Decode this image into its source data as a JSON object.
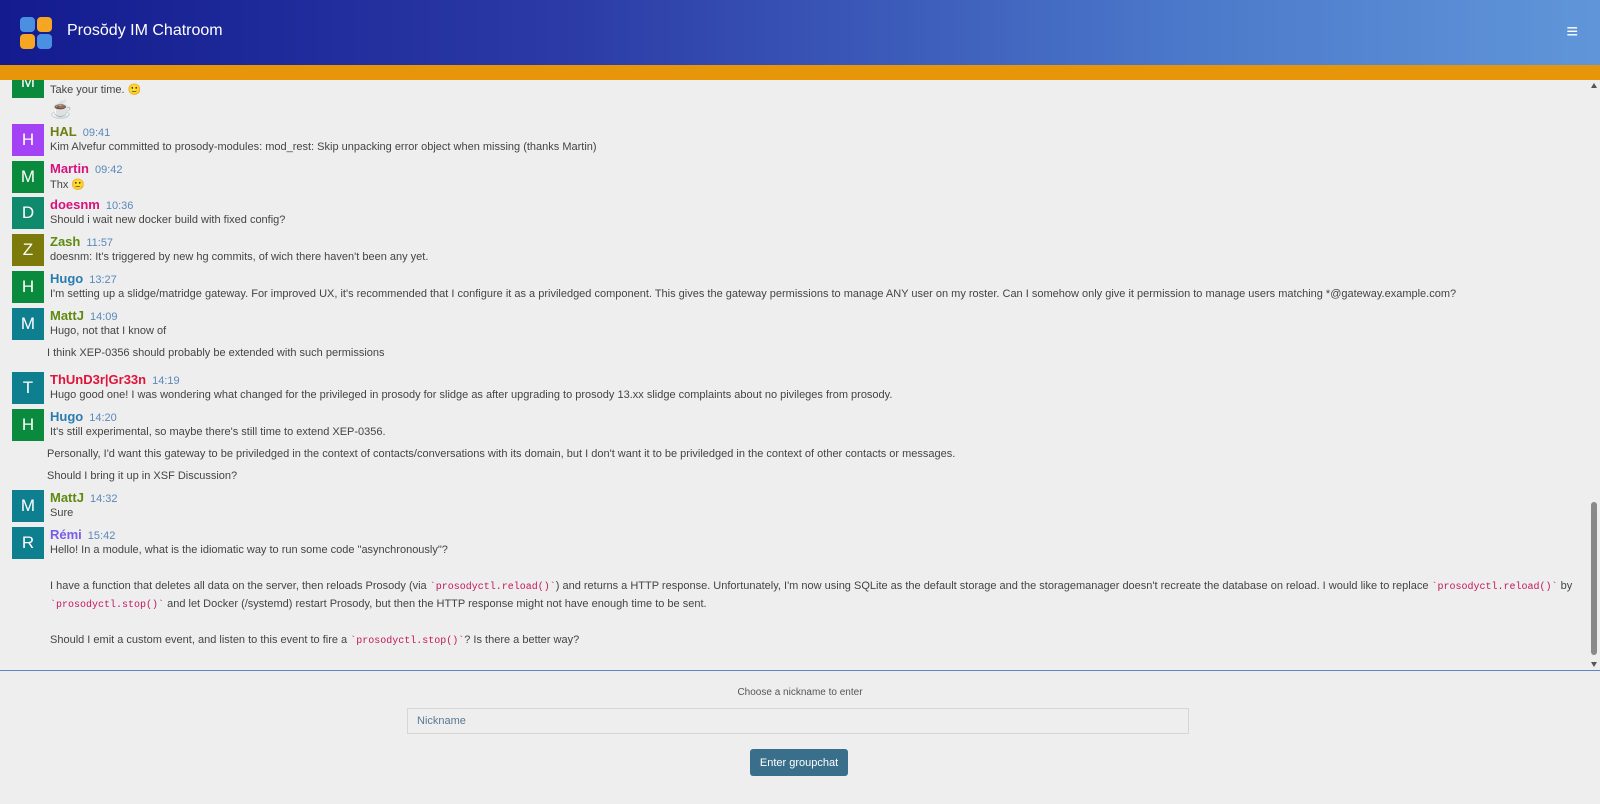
{
  "header": {
    "title": "Prosŏdy IM Chatroom",
    "logo_icon": "prosody-logo-icon",
    "menu_icon": "hamburger-menu-icon",
    "menu_glyph": "≡",
    "colors": {
      "brand_blue": "#131b8e",
      "accent_orange": "#e89609"
    }
  },
  "messages": [
    {
      "text": "Take your time. 🙂",
      "avatar_letter": "M",
      "avatar_color": "#0a8a3c"
    },
    {
      "text": "☕"
    },
    {
      "avatar_letter": "H",
      "avatar_color": "#a442f5",
      "nick": "HAL",
      "nick_color": "#6d7d10",
      "time": "09:41",
      "text": "Kim Alvefur committed to prosody-modules: mod_rest: Skip unpacking error object when missing (thanks Martin)"
    },
    {
      "avatar_letter": "M",
      "avatar_color": "#0a8a3c",
      "nick": "Martin",
      "nick_color": "#d8127c",
      "time": "09:42",
      "text": "Thx 🙂"
    },
    {
      "avatar_letter": "D",
      "avatar_color": "#0f8a6c",
      "nick": "doesnm",
      "nick_color": "#d8127c",
      "time": "10:36",
      "text": "Should i wait new docker build with fixed config?"
    },
    {
      "avatar_letter": "Z",
      "avatar_color": "#7c7a0a",
      "nick": "Zash",
      "nick_color": "#5f8a10",
      "time": "11:57",
      "text": "doesnm: It's triggered by new hg commits, of wich there haven't been any yet."
    },
    {
      "avatar_letter": "H",
      "avatar_color": "#0a8a3c",
      "nick": "Hugo",
      "nick_color": "#2a7bb0",
      "time": "13:27",
      "text": "I'm setting up a slidge/matridge gateway. For improved UX, it's recommended that I configure it as a priviledged component. This gives the gateway permissions to manage ANY user on my roster. Can I somehow only give it permission to manage users matching *@gateway.example.com?"
    },
    {
      "avatar_letter": "M",
      "avatar_color": "#0d7f8f",
      "nick": "MattJ",
      "nick_color": "#5f8a10",
      "time": "14:09",
      "text": "Hugo, not that I know of",
      "extra": [
        "I think XEP-0356 should probably be extended with such permissions"
      ]
    },
    {
      "avatar_letter": "T",
      "avatar_color": "#0d7f8f",
      "nick": "ThUnD3r|Gr33n",
      "nick_color": "#e0133a",
      "time": "14:19",
      "text": "Hugo good one! I was wondering what changed for the privileged in prosody for slidge as after upgrading to prosody 13.xx slidge complaints about no pivileges from prosody."
    },
    {
      "avatar_letter": "H",
      "avatar_color": "#0a8a3c",
      "nick": "Hugo",
      "nick_color": "#2a7bb0",
      "time": "14:20",
      "text": "It's still experimental, so maybe there's still time to extend XEP-0356.",
      "extra": [
        "Personally, I'd want this gateway to be priviledged in the context of contacts/conversations with its domain, but I don't want it to be priviledged in the context of other contacts or messages.",
        "Should I bring it up in XSF Discussion?"
      ]
    },
    {
      "avatar_letter": "M",
      "avatar_color": "#0d7f8f",
      "nick": "MattJ",
      "nick_color": "#5f8a10",
      "time": "14:32",
      "text": "Sure"
    },
    {
      "avatar_letter": "R",
      "avatar_color": "#0d7f8f",
      "nick": "Rémi",
      "nick_color": "#7b5ce8",
      "time": "15:42",
      "text": "Hello! In a module, what is the idiomatic way to run some code \"asynchronously\"?",
      "para1_a": "I have a function that deletes all data on the server, then reloads Prosody (via ",
      "para1_code1": "`prosodyctl.reload()`",
      "para1_b": ") and returns a HTTP response. Unfortunately, I'm now using SQLite as the default storage and the storagemanager doesn't recreate the database on reload. I would like to replace ",
      "para1_code2": "`prosodyctl.reload()`",
      "para1_c": " by",
      "para1_code3": "`prosodyctl.stop()`",
      "para1_d": " and let Docker (/systemd) restart Prosody, but then the HTTP response might not have enough time to be sent.",
      "para2_a": "Should I emit a custom event, and listen to this event to fire a ",
      "para2_code": "`prosodyctl.stop()`",
      "para2_b": "? Is there a better way?"
    }
  ],
  "footer": {
    "prompt": "Choose a nickname to enter",
    "nickname_placeholder": "Nickname",
    "nickname_value": "",
    "enter_label": "Enter groupchat"
  }
}
